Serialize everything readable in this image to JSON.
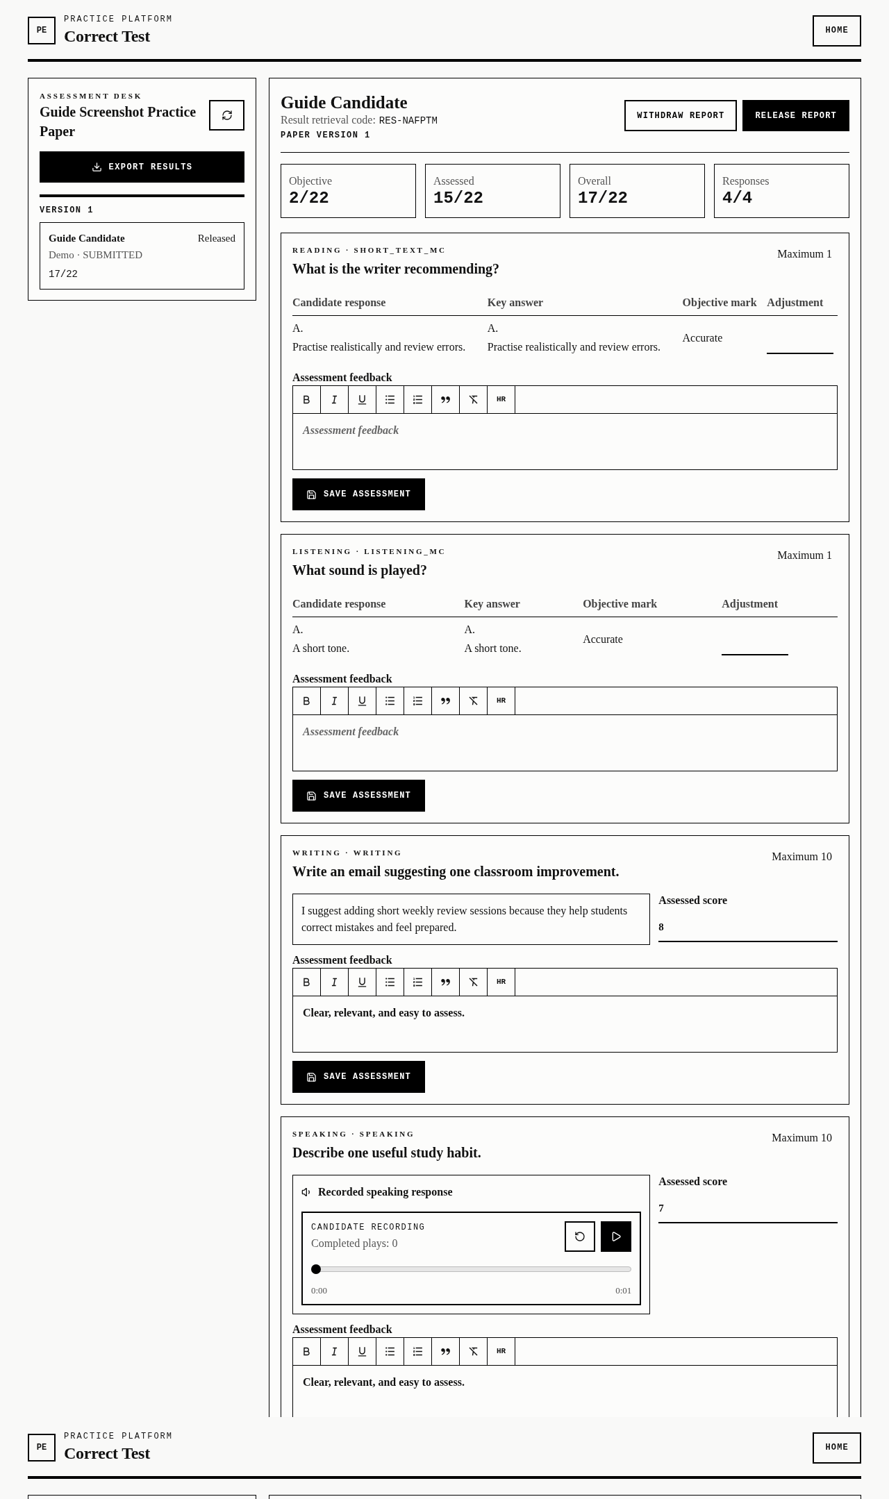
{
  "header": {
    "logo": "PE",
    "eyebrow": "PRACTICE PLATFORM",
    "title": "Correct Test",
    "home_button": "HOME"
  },
  "sidebar": {
    "eyebrow": "ASSESSMENT DESK",
    "title": "Guide Screenshot Practice Paper",
    "export_button": "EXPORT RESULTS",
    "version_label": "VERSION 1",
    "candidates": [
      {
        "name": "Guide Candidate",
        "status": "Released",
        "meta": "Demo · SUBMITTED",
        "score": "17/22"
      }
    ]
  },
  "main": {
    "title": "Guide Candidate",
    "code_label": "Result retrieval code:",
    "code": "RES-NAFPTM",
    "version": "PAPER VERSION 1",
    "actions": [
      {
        "label": "WITHDRAW REPORT",
        "kind": "outline"
      },
      {
        "label": "RELEASE REPORT",
        "kind": "solid"
      }
    ],
    "stats": [
      {
        "label": "Objective",
        "value": "2/22"
      },
      {
        "label": "Assessed",
        "value": "15/22"
      },
      {
        "label": "Overall",
        "value": "17/22"
      },
      {
        "label": "Responses",
        "value": "4/4"
      }
    ],
    "questions": [
      {
        "kind": "choice",
        "tag": "READING · SHORT_TEXT_MC",
        "prompt": "What is the writer recommending?",
        "maximum": "Maximum 1",
        "columns": [
          "Candidate response",
          "Key answer",
          "Objective mark",
          "Adjustment"
        ],
        "rows": [
          {
            "candidate_response": {
              "option": "A.",
              "text": "Practise realistically and review errors."
            },
            "key_answer": {
              "option": "A.",
              "text": "Practise realistically and review errors."
            },
            "objective_mark": "Accurate"
          }
        ],
        "feedback": {
          "label": "Assessment feedback",
          "rule_button": "HR",
          "placeholder": "Assessment feedback"
        },
        "save_button": "SAVE ASSESSMENT"
      },
      {
        "kind": "choice",
        "tag": "LISTENING · LISTENING_MC",
        "prompt": "What sound is played?",
        "maximum": "Maximum 1",
        "columns": [
          "Candidate response",
          "Key answer",
          "Objective mark",
          "Adjustment"
        ],
        "rows": [
          {
            "candidate_response": {
              "option": "A.",
              "text": "A short tone."
            },
            "key_answer": {
              "option": "A.",
              "text": "A short tone."
            },
            "objective_mark": "Accurate"
          }
        ],
        "feedback": {
          "label": "Assessment feedback",
          "rule_button": "HR",
          "placeholder": "Assessment feedback"
        },
        "save_button": "SAVE ASSESSMENT"
      },
      {
        "kind": "writing",
        "tag": "WRITING · WRITING",
        "prompt": "Write an email suggesting one classroom improvement.",
        "maximum": "Maximum 10",
        "response": "I suggest adding short weekly review sessions because they help students correct mistakes and feel prepared.",
        "score": {
          "label": "Assessed score",
          "value": "8"
        },
        "feedback": {
          "label": "Assessment feedback",
          "rule_button": "HR",
          "value": "Clear, relevant, and easy to assess."
        },
        "save_button": "SAVE ASSESSMENT"
      },
      {
        "kind": "speaking",
        "tag": "SPEAKING · SPEAKING",
        "prompt": "Describe one useful study habit.",
        "maximum": "Maximum 10",
        "recording": {
          "heading": "Recorded speaking response",
          "title": "CANDIDATE RECORDING",
          "plays": "Completed plays: 0",
          "level": 0,
          "elapsed": "0:00",
          "duration": "0:01"
        },
        "score": {
          "label": "Assessed score",
          "value": "7"
        },
        "feedback": {
          "label": "Assessment feedback",
          "rule_button": "HR",
          "value": "Clear, relevant, and easy to assess."
        }
      }
    ]
  },
  "repeated_header": {
    "logo": "PE",
    "eyebrow": "PRACTICE PLATFORM",
    "title": "Correct Test",
    "home_button": "HOME"
  }
}
